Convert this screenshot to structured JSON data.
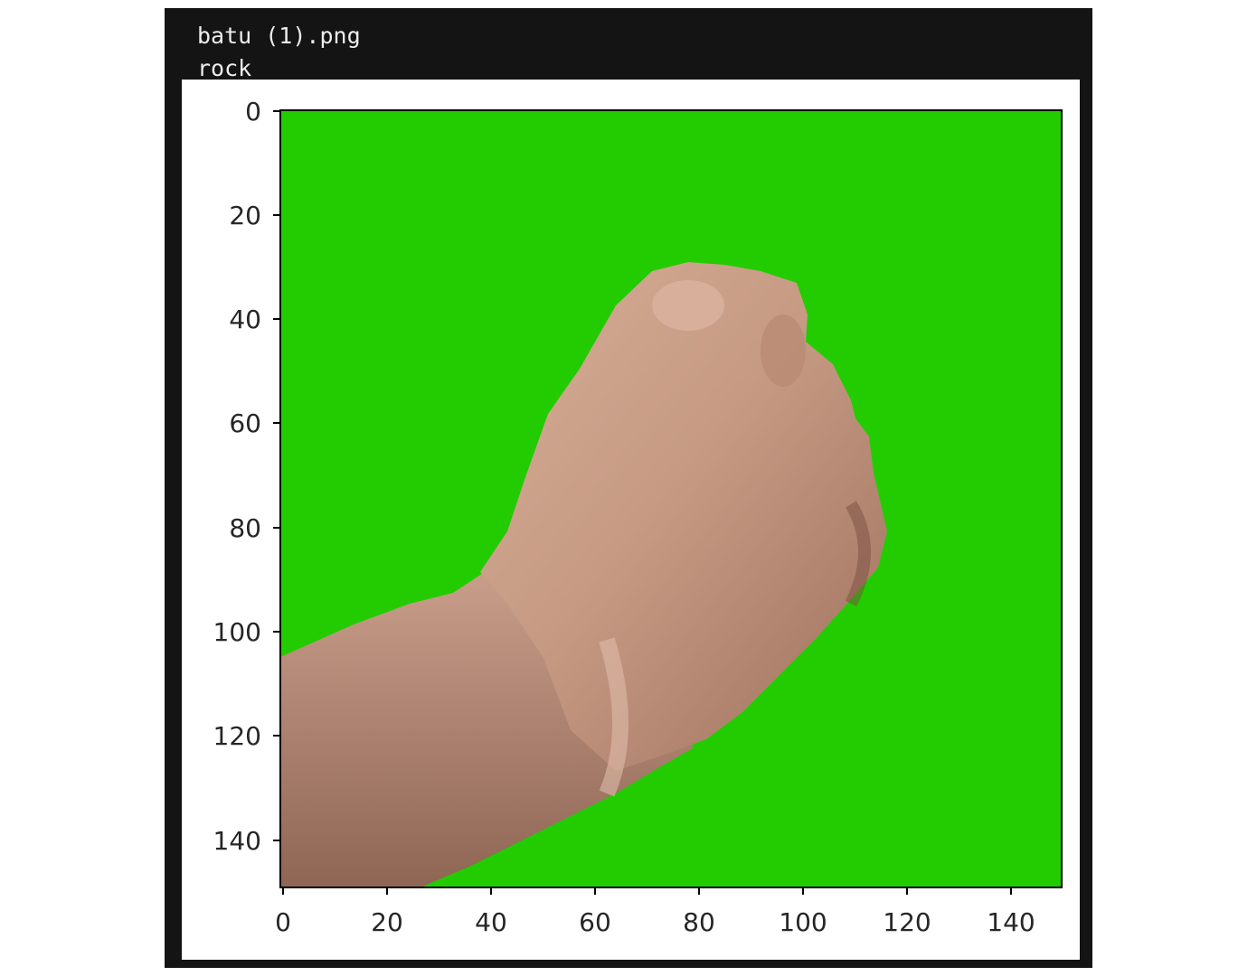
{
  "output": {
    "filename": "batu (1).png",
    "label": "rock"
  },
  "chart_data": {
    "type": "image",
    "title": "",
    "xlabel": "",
    "ylabel": "",
    "xlim": [
      0,
      150
    ],
    "ylim": [
      150,
      0
    ],
    "x_ticks": [
      0,
      20,
      40,
      60,
      80,
      100,
      120,
      140
    ],
    "y_ticks": [
      0,
      20,
      40,
      60,
      80,
      100,
      120,
      140
    ],
    "grid": false,
    "content": "fist",
    "background_color": "#22cc00",
    "skin_color": "#c79a82"
  }
}
